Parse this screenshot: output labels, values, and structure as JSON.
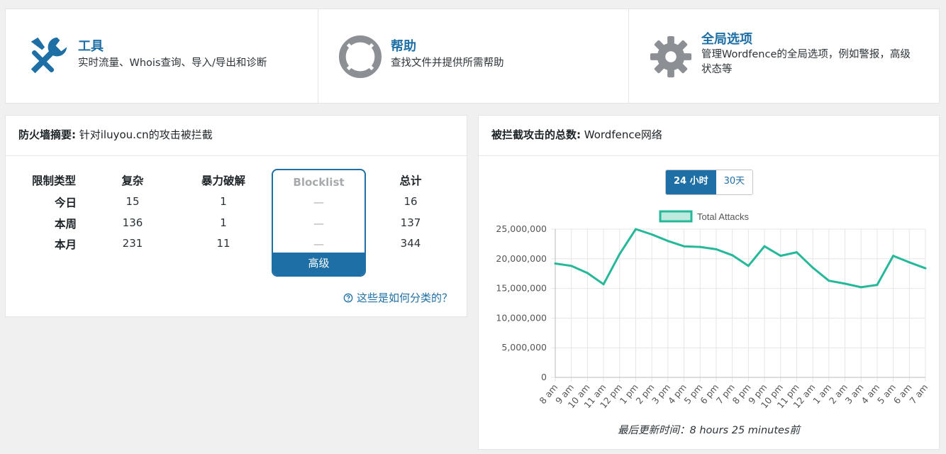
{
  "tiles": [
    {
      "title": "工具",
      "desc": "实时流量、Whois查询、导入/导出和诊断",
      "icon": "tools-icon"
    },
    {
      "title": "帮助",
      "desc": "查找文件并提供所需帮助",
      "icon": "lifebuoy-icon"
    },
    {
      "title": "全局选项",
      "desc": "管理Wordfence的全局选项，例如警报，高级状态等",
      "icon": "gear-icon"
    }
  ],
  "firewall": {
    "title_bold": "防火墙摘要:",
    "title_rest": " 针对iluyou.cn的攻击被拦截",
    "headers": {
      "type": "限制类型",
      "complex": "复杂",
      "brute": "暴力破解",
      "blocklist": "Blocklist",
      "total": "总计"
    },
    "rows": [
      {
        "label": "今日",
        "complex": "15",
        "brute": "1",
        "blocklist": "—",
        "total": "16"
      },
      {
        "label": "本周",
        "complex": "136",
        "brute": "1",
        "blocklist": "—",
        "total": "137"
      },
      {
        "label": "本月",
        "complex": "231",
        "brute": "11",
        "blocklist": "—",
        "total": "344"
      }
    ],
    "premium_label": "高级",
    "how_link": "这些是如何分类的？"
  },
  "attacks": {
    "title_bold": "被拦截攻击的总数:",
    "title_rest": " Wordfence网络",
    "tab_24h": "24 小时",
    "tab_30d": "30天",
    "updated": "最后更新时间：8 hours 25 minutes前"
  },
  "chart_data": {
    "type": "line",
    "categories": [
      "8 am",
      "9 am",
      "10 am",
      "11 am",
      "12 pm",
      "1 pm",
      "2 pm",
      "3 pm",
      "4 pm",
      "5 pm",
      "6 pm",
      "7 pm",
      "8 pm",
      "9 pm",
      "10 pm",
      "11 pm",
      "12 am",
      "1 am",
      "2 am",
      "3 am",
      "4 am",
      "5 am",
      "6 am",
      "7 am"
    ],
    "series": [
      {
        "name": "Total Attacks",
        "values": [
          19200000,
          18800000,
          17600000,
          15700000,
          20800000,
          25000000,
          24100000,
          23000000,
          22100000,
          22000000,
          21600000,
          20600000,
          18800000,
          22100000,
          20500000,
          21100000,
          18500000,
          16300000,
          15800000,
          15200000,
          15600000,
          20500000,
          19400000,
          18400000
        ]
      }
    ],
    "ylim": [
      0,
      25000000
    ],
    "yticks": [
      "0",
      "5,000,000",
      "10,000,000",
      "15,000,000",
      "20,000,000",
      "25,000,000"
    ],
    "line_color": "#26b999",
    "fill_color": "#bde9df",
    "legend": "top"
  }
}
